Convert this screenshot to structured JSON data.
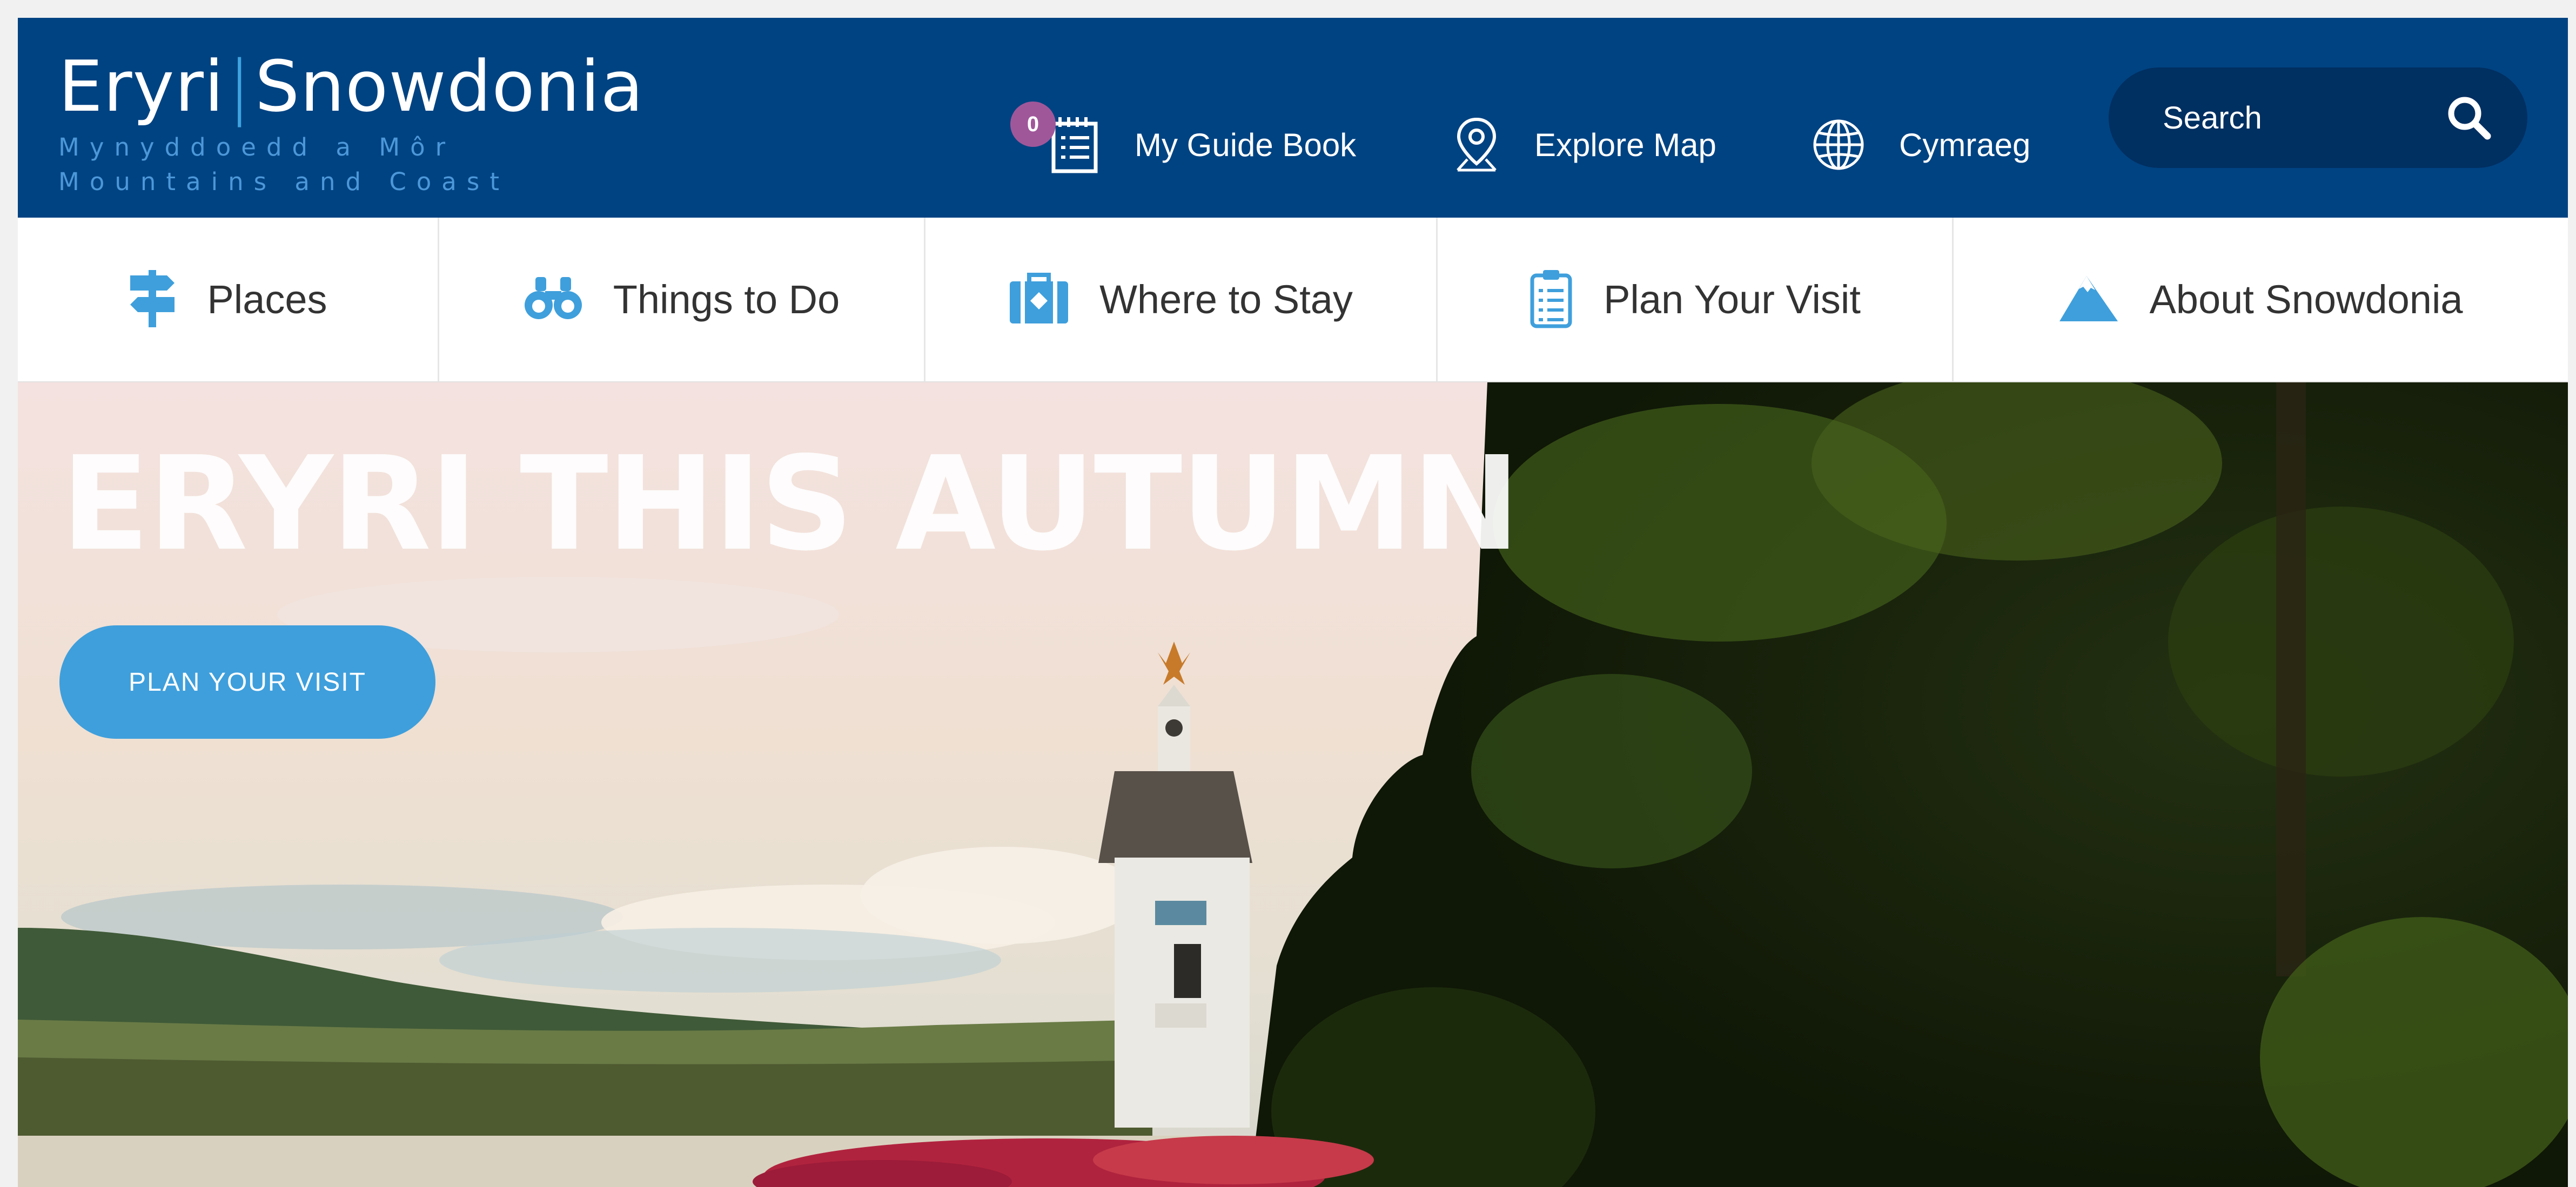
{
  "header": {
    "logo": {
      "name_welsh": "Eryri",
      "separator": "|",
      "name_english": "Snowdonia",
      "tagline_welsh": "Mynyddoedd a Môr",
      "tagline_english": "Mountains and Coast"
    },
    "guide_book": {
      "label": "My Guide Book",
      "count": "0",
      "icon": "guide-book-icon"
    },
    "explore_map": {
      "label": "Explore Map",
      "icon": "map-pin-icon"
    },
    "language": {
      "label": "Cymraeg",
      "icon": "globe-icon"
    },
    "search": {
      "placeholder": "Search",
      "icon": "search-icon"
    }
  },
  "main_nav": {
    "items": [
      {
        "label": "Places",
        "icon": "signpost-icon"
      },
      {
        "label": "Things to Do",
        "icon": "binoculars-icon"
      },
      {
        "label": "Where to Stay",
        "icon": "suitcase-icon"
      },
      {
        "label": "Plan Your Visit",
        "icon": "clipboard-icon"
      },
      {
        "label": "About Snowdonia",
        "icon": "mountain-icon"
      }
    ]
  },
  "hero": {
    "title": "ERYRI THIS AUTUMN",
    "cta_label": "PLAN YOUR VISIT"
  },
  "colors": {
    "header_bg": "#004382",
    "search_bg": "#002f61",
    "accent_blue": "#3f9fdc",
    "badge_purple": "#a0579a",
    "nav_text": "#333333"
  }
}
